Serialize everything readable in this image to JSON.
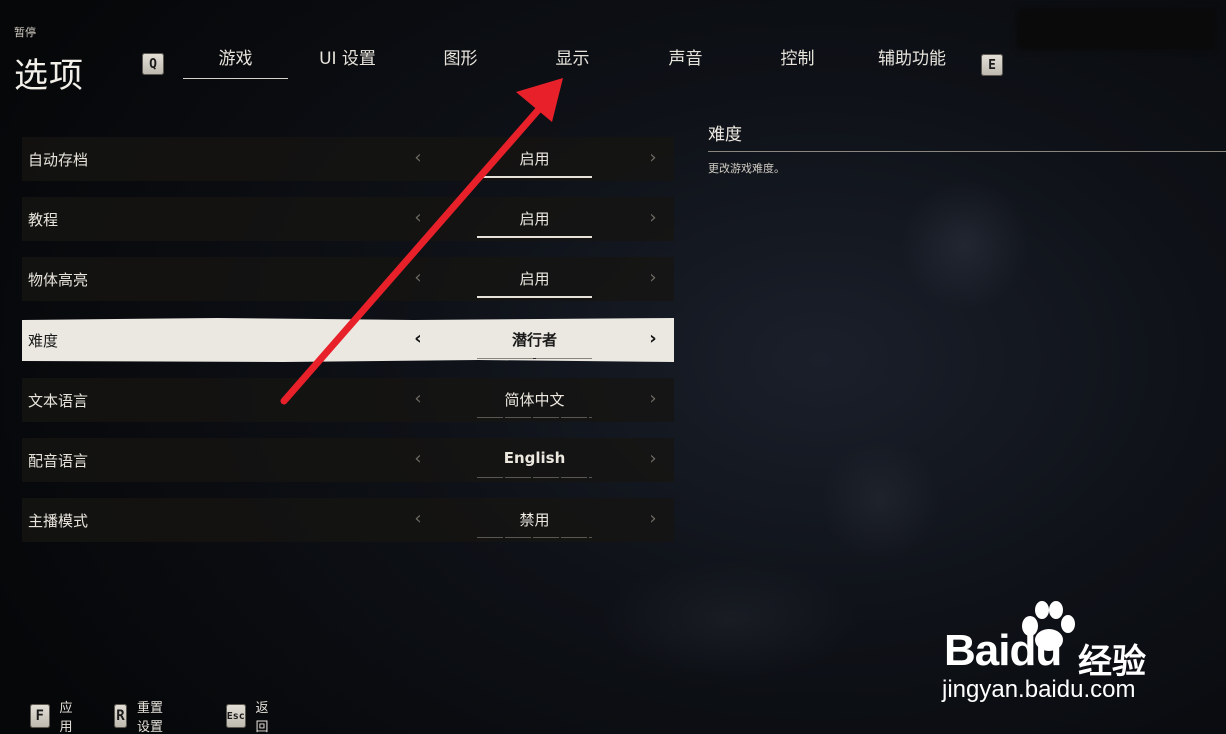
{
  "header": {
    "pause_label": "暂停",
    "title": "选项",
    "prev_key": "Q",
    "next_key": "E"
  },
  "tabs": [
    {
      "label": "游戏",
      "active": true
    },
    {
      "label": "UI 设置",
      "active": false
    },
    {
      "label": "图形",
      "active": false
    },
    {
      "label": "显示",
      "active": false
    },
    {
      "label": "声音",
      "active": false
    },
    {
      "label": "控制",
      "active": false
    },
    {
      "label": "辅助功能",
      "active": false
    }
  ],
  "settings": [
    {
      "label": "自动存档",
      "value": "启用"
    },
    {
      "label": "教程",
      "value": "启用"
    },
    {
      "label": "物体高亮",
      "value": "启用"
    },
    {
      "label": "难度",
      "value": "潜行者",
      "selected": true
    },
    {
      "label": "文本语言",
      "value": "简体中文"
    },
    {
      "label": "配音语言",
      "value": "English"
    },
    {
      "label": "主播模式",
      "value": "禁用"
    }
  ],
  "arrows": {
    "left": "‹",
    "right": "›"
  },
  "description": {
    "title": "难度",
    "text": "更改游戏难度。"
  },
  "footer": [
    {
      "key": "F",
      "label": "应用"
    },
    {
      "key": "R",
      "label": "重置设置"
    },
    {
      "key": "Esc",
      "label": "返回"
    }
  ],
  "watermark": {
    "logo": "Baidu",
    "cn": "经验",
    "url": "jingyan.baidu.com"
  },
  "colors": {
    "annotation_arrow": "#e8202a",
    "selected_row_bg": "#ebe8e1"
  }
}
